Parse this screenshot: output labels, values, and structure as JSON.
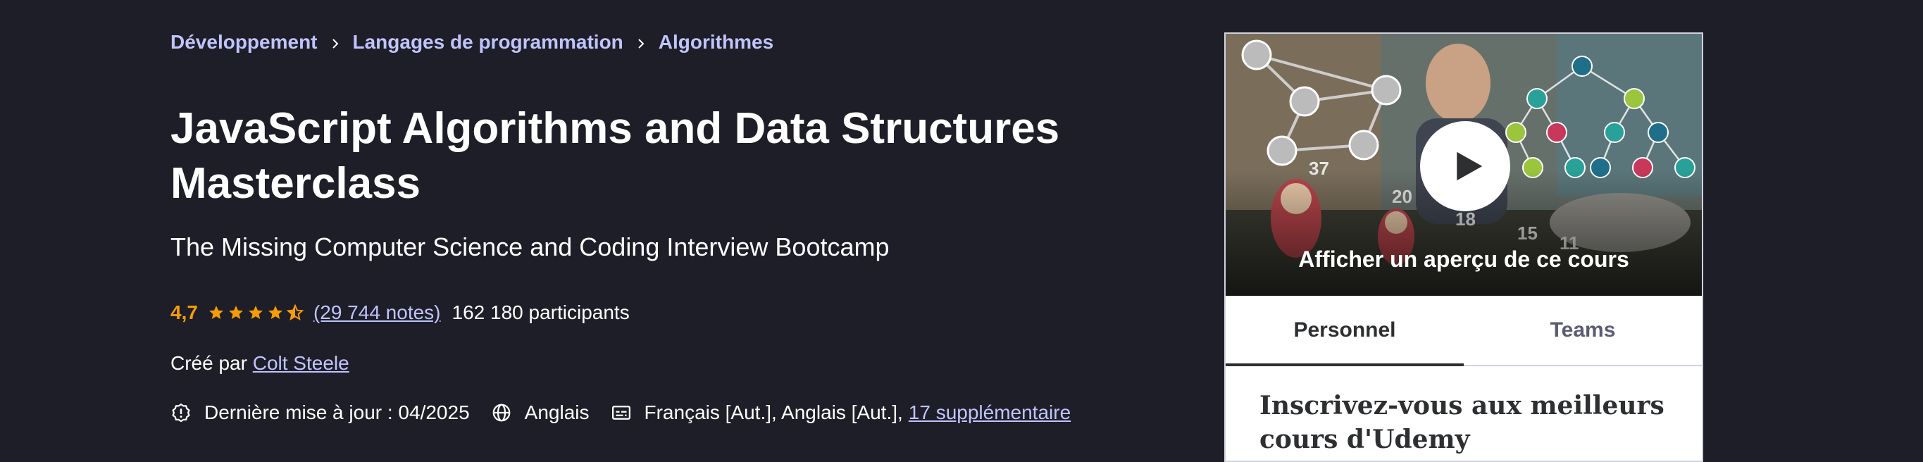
{
  "breadcrumb": {
    "items": [
      "Développement",
      "Langages de programmation",
      "Algorithmes"
    ]
  },
  "course": {
    "title": "JavaScript Algorithms and Data Structures Masterclass",
    "subtitle": "The Missing Computer Science and Coding Interview Bootcamp",
    "rating": "4,7",
    "rating_value": 4.7,
    "rating_max": 5,
    "reviews": "(29 744 notes)",
    "participants": "162 180 participants",
    "created_by_label": "Créé par",
    "instructor": "Colt Steele",
    "last_update": "Dernière mise à jour : 04/2025",
    "language": "Anglais",
    "captions": "Français [Aut.], Anglais [Aut.],",
    "captions_more": "17 supplémentaire"
  },
  "card": {
    "preview_label": "Afficher un aperçu de ce cours",
    "tabs": [
      "Personnel",
      "Teams"
    ],
    "active_tab": "Personnel",
    "heading": "Inscrivez-vous aux meilleurs cours d'Udemy"
  },
  "preview_numbers": [
    "37",
    "20",
    "18",
    "15",
    "11"
  ],
  "icons": {
    "breadcrumb_separator": "chevron-right-icon",
    "update": "alert-badge-icon",
    "language": "globe-icon",
    "captions": "captions-icon",
    "play": "play-icon"
  },
  "colors": {
    "background": "#1d1e27",
    "link": "#c0c4fc",
    "rating": "#f69c08",
    "text": "#ffffff"
  }
}
